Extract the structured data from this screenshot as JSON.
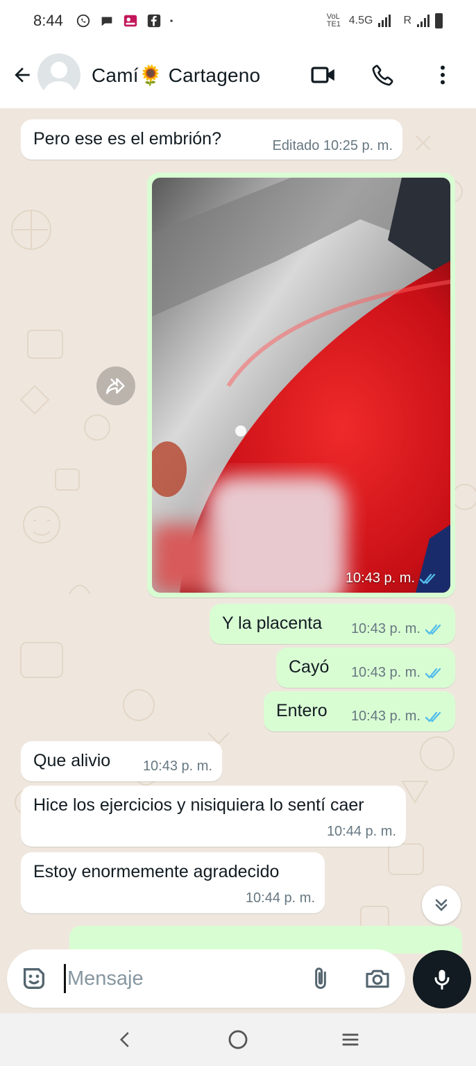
{
  "status_bar": {
    "time": "8:44",
    "network": "4.5G",
    "roaming": "R",
    "lte_label": "VoLTE1",
    "icons": [
      "whatsapp-icon",
      "chat-bubble-icon",
      "photo-app-icon",
      "facebook-icon",
      "dot-icon"
    ]
  },
  "header": {
    "contact_name": "Camí🌻 Cartageno",
    "icons": [
      "back-arrow-icon",
      "avatar",
      "video-call-icon",
      "phone-call-icon",
      "more-vert-icon"
    ]
  },
  "messages": [
    {
      "direction": "in",
      "text": "Pero ese es el embrión?",
      "time": "Editado 10:25 p. m."
    },
    {
      "direction": "out",
      "type": "image",
      "time": "10:43 p. m.",
      "status": "read"
    },
    {
      "direction": "out",
      "text": "Y la placenta",
      "time": "10:43 p. m.",
      "status": "read"
    },
    {
      "direction": "out",
      "text": "Cayó",
      "time": "10:43 p. m.",
      "status": "read"
    },
    {
      "direction": "out",
      "text": "Entero",
      "time": "10:43 p. m.",
      "status": "read"
    },
    {
      "direction": "in",
      "text": "Que alivio",
      "time": "10:43 p. m."
    },
    {
      "direction": "in",
      "text": "Hice los ejercicios y nisiquiera lo sentí caer",
      "time": "10:44 p. m."
    },
    {
      "direction": "in",
      "text": "Estoy enormemente agradecido",
      "time": "10:44 p. m."
    }
  ],
  "composer": {
    "placeholder": "Mensaje",
    "icons": [
      "sticker-icon",
      "attach-icon",
      "camera-icon",
      "mic-icon"
    ]
  },
  "colors": {
    "chat_bg": "#efe7de",
    "incoming": "#ffffff",
    "outgoing": "#d9fdd3",
    "read_ticks": "#53bdeb",
    "meta_text": "#667781"
  },
  "nav": {
    "icons": [
      "nav-back-icon",
      "nav-home-icon",
      "nav-recents-icon"
    ]
  }
}
